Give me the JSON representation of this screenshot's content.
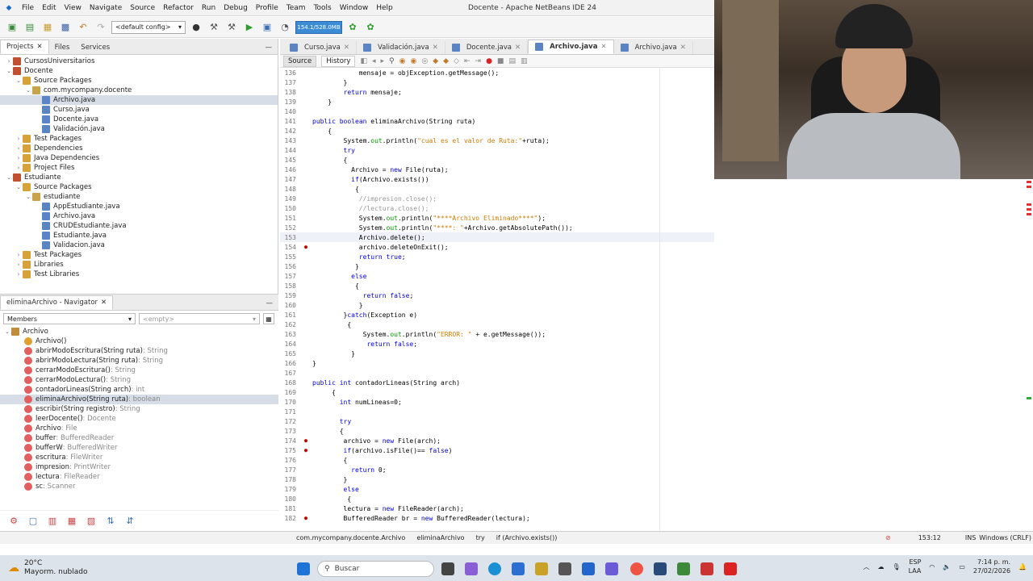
{
  "menubar": {
    "items": [
      "File",
      "Edit",
      "View",
      "Navigate",
      "Source",
      "Refactor",
      "Run",
      "Debug",
      "Profile",
      "Team",
      "Tools",
      "Window",
      "Help"
    ],
    "title": "Docente - Apache NetBeans IDE 24"
  },
  "toolbar": {
    "config": "<default config>",
    "memory": "154.1/528.0MB"
  },
  "projects": {
    "tabs": [
      "Projects",
      "Files",
      "Services"
    ],
    "tree": [
      {
        "label": "CursosUniversitarios",
        "indent": 0,
        "kind": "project",
        "toggle": "+"
      },
      {
        "label": "Docente",
        "indent": 0,
        "kind": "project",
        "toggle": "-"
      },
      {
        "label": "Source Packages",
        "indent": 1,
        "kind": "folder",
        "toggle": "-"
      },
      {
        "label": "com.mycompany.docente",
        "indent": 2,
        "kind": "package",
        "toggle": "-"
      },
      {
        "label": "Archivo.java",
        "indent": 3,
        "kind": "java",
        "selected": true
      },
      {
        "label": "Curso.java",
        "indent": 3,
        "kind": "java"
      },
      {
        "label": "Docente.java",
        "indent": 3,
        "kind": "java"
      },
      {
        "label": "Validación.java",
        "indent": 3,
        "kind": "java"
      },
      {
        "label": "Test Packages",
        "indent": 1,
        "kind": "folder",
        "toggle": "+"
      },
      {
        "label": "Dependencies",
        "indent": 1,
        "kind": "folder",
        "toggle": "+"
      },
      {
        "label": "Java Dependencies",
        "indent": 1,
        "kind": "folder",
        "toggle": "+"
      },
      {
        "label": "Project Files",
        "indent": 1,
        "kind": "folder",
        "toggle": "+"
      },
      {
        "label": "Estudiante",
        "indent": 0,
        "kind": "project",
        "toggle": "-"
      },
      {
        "label": "Source Packages",
        "indent": 1,
        "kind": "folder",
        "toggle": "-"
      },
      {
        "label": "estudiante",
        "indent": 2,
        "kind": "package",
        "toggle": "-"
      },
      {
        "label": "AppEstudiante.java",
        "indent": 3,
        "kind": "java"
      },
      {
        "label": "Archivo.java",
        "indent": 3,
        "kind": "java"
      },
      {
        "label": "CRUDEstudiante.java",
        "indent": 3,
        "kind": "java"
      },
      {
        "label": "Estudiante.java",
        "indent": 3,
        "kind": "java"
      },
      {
        "label": "Validacion.java",
        "indent": 3,
        "kind": "java"
      },
      {
        "label": "Test Packages",
        "indent": 1,
        "kind": "folder",
        "toggle": "+"
      },
      {
        "label": "Libraries",
        "indent": 1,
        "kind": "folder",
        "toggle": "+"
      },
      {
        "label": "Test Libraries",
        "indent": 1,
        "kind": "folder",
        "toggle": "+"
      }
    ]
  },
  "navigator": {
    "title": "eliminaArchivo - Navigator",
    "members_label": "Members",
    "empty_label": "<empty>",
    "root": "Archivo",
    "items": [
      {
        "name": "Archivo()",
        "type": "",
        "kind": "ctor"
      },
      {
        "name": "abrirModoEscritura(String ruta)",
        "type": " : String",
        "kind": "method"
      },
      {
        "name": "abrirModoLectura(String ruta)",
        "type": " : String",
        "kind": "method"
      },
      {
        "name": "cerrarModoEscritura()",
        "type": " : String",
        "kind": "method"
      },
      {
        "name": "cerrarModoLectura()",
        "type": " : String",
        "kind": "method"
      },
      {
        "name": "contadorLineas(String arch)",
        "type": " : int",
        "kind": "method"
      },
      {
        "name": "eliminaArchivo(String ruta)",
        "type": " : boolean",
        "kind": "method",
        "selected": true
      },
      {
        "name": "escribir(String registro)",
        "type": " : String",
        "kind": "method"
      },
      {
        "name": "leerDocente()",
        "type": " : Docente",
        "kind": "method"
      },
      {
        "name": "Archivo",
        "type": " : File",
        "kind": "field"
      },
      {
        "name": "buffer",
        "type": " : BufferedReader",
        "kind": "field"
      },
      {
        "name": "bufferW",
        "type": " : BufferedWriter",
        "kind": "field"
      },
      {
        "name": "escritura",
        "type": " : FileWriter",
        "kind": "field"
      },
      {
        "name": "impresion",
        "type": " : PrintWriter",
        "kind": "field"
      },
      {
        "name": "lectura",
        "type": " : FileReader",
        "kind": "field"
      },
      {
        "name": "sc",
        "type": " : Scanner",
        "kind": "field"
      }
    ]
  },
  "editor": {
    "tabs": [
      "Curso.java",
      "Validación.java",
      "Docente.java",
      "Archivo.java",
      "Archivo.java"
    ],
    "active_tab": 3,
    "modes": [
      "Source",
      "History"
    ],
    "lines": [
      {
        "n": "136",
        "code": "            mensaje = objException.getMessage();"
      },
      {
        "n": "137",
        "code": "        }"
      },
      {
        "n": "138",
        "code": "        return mensaje;"
      },
      {
        "n": "139",
        "code": "    }"
      },
      {
        "n": "140",
        "code": ""
      },
      {
        "n": "141",
        "code": "public boolean eliminaArchivo(String ruta)"
      },
      {
        "n": "142",
        "code": "    {"
      },
      {
        "n": "143",
        "code": "        System.out.println(\"cual es el valor de Ruta:\"+ruta);"
      },
      {
        "n": "144",
        "code": "        try"
      },
      {
        "n": "145",
        "code": "        {"
      },
      {
        "n": "146",
        "code": "          Archivo = new File(ruta);"
      },
      {
        "n": "147",
        "code": "          if(Archivo.exists())"
      },
      {
        "n": "148",
        "code": "           {"
      },
      {
        "n": "149",
        "code": "            //impresion.close();"
      },
      {
        "n": "150",
        "code": "            //lectura.close();"
      },
      {
        "n": "151",
        "code": "            System.out.println(\"****Archivo Eliminado****\");"
      },
      {
        "n": "152",
        "code": "            System.out.println(\"****: \"+Archivo.getAbsolutePath());"
      },
      {
        "n": "153",
        "code": "            Archivo.delete();",
        "current": true
      },
      {
        "n": "154",
        "code": "            archivo.deleteOnExit();",
        "error": true
      },
      {
        "n": "155",
        "code": "            return true;"
      },
      {
        "n": "156",
        "code": "           }"
      },
      {
        "n": "157",
        "code": "          else"
      },
      {
        "n": "158",
        "code": "           {"
      },
      {
        "n": "159",
        "code": "             return false;"
      },
      {
        "n": "160",
        "code": "            }"
      },
      {
        "n": "161",
        "code": "        }catch(Exception e)"
      },
      {
        "n": "162",
        "code": "         {"
      },
      {
        "n": "163",
        "code": "             System.out.println(\"ERROR: \" + e.getMessage());"
      },
      {
        "n": "164",
        "code": "              return false;"
      },
      {
        "n": "165",
        "code": "          }"
      },
      {
        "n": "166",
        "code": "}"
      },
      {
        "n": "167",
        "code": ""
      },
      {
        "n": "168",
        "code": "public int contadorLineas(String arch)"
      },
      {
        "n": "169",
        "code": "     {"
      },
      {
        "n": "170",
        "code": "       int numLineas=0;"
      },
      {
        "n": "171",
        "code": ""
      },
      {
        "n": "172",
        "code": "       try"
      },
      {
        "n": "173",
        "code": "       {"
      },
      {
        "n": "174",
        "code": "        archivo = new File(arch);",
        "error": true
      },
      {
        "n": "175",
        "code": "        if(archivo.isFile()== false)",
        "error": true
      },
      {
        "n": "176",
        "code": "        {"
      },
      {
        "n": "177",
        "code": "          return 0;"
      },
      {
        "n": "178",
        "code": "        }"
      },
      {
        "n": "179",
        "code": "        else"
      },
      {
        "n": "180",
        "code": "         {"
      },
      {
        "n": "181",
        "code": "        lectura = new FileReader(arch);"
      },
      {
        "n": "182",
        "code": "        BufferedReader br = new BufferedReader(lectura);",
        "error": true
      }
    ]
  },
  "statusbar": {
    "breadcrumbs": [
      "com.mycompany.docente.Archivo",
      "eliminaArchivo",
      "try",
      "if (Archivo.exists())"
    ],
    "position": "153:12",
    "mode": "INS",
    "line_ending": "Windows (CRLF)"
  },
  "taskbar": {
    "weather_temp": "20°C",
    "weather_desc": "Mayorm. nublado",
    "search": "Buscar",
    "lang": "ESP",
    "lang2": "LAA",
    "time": "7:14 p. m.",
    "date": "27/02/2026"
  }
}
